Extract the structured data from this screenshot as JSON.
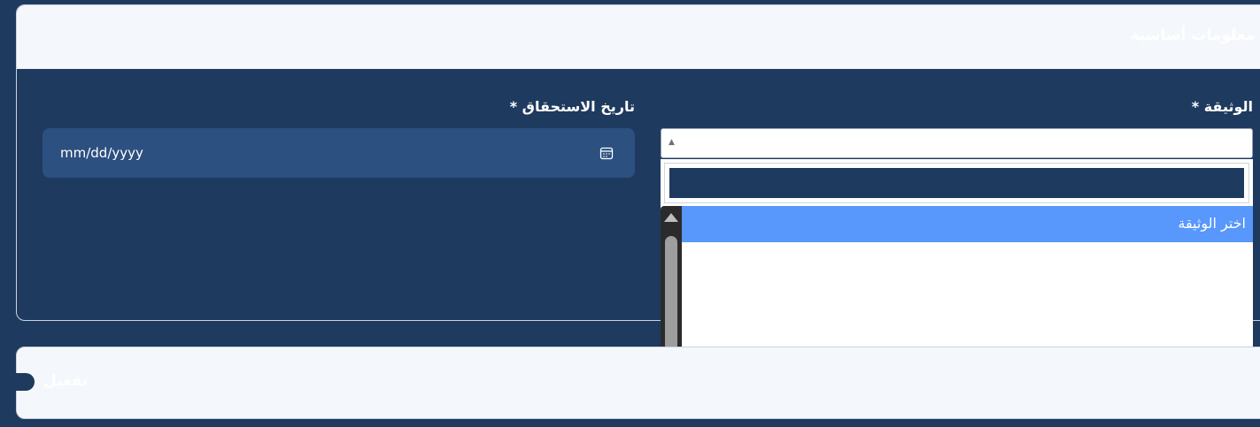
{
  "basic_info": {
    "title": "معلومات أساسية"
  },
  "fields": {
    "document": {
      "label": "الوثيقة *",
      "search_value": "",
      "options": [
        {
          "label": "اختر الوثيقة",
          "highlighted": true
        }
      ]
    },
    "due_date": {
      "label": "تاريخ الاستحقاق *",
      "placeholder": "mm/dd/yyyy"
    }
  },
  "activation": {
    "label": "تفعيل"
  },
  "colors": {
    "page_background": "#1f3a5f",
    "card_header": "#f4f7fb",
    "date_input": "#2c5080",
    "option_highlight": "#5897fb"
  },
  "icons": {
    "date": "calendar-icon",
    "select": "triangle-up-icon"
  }
}
